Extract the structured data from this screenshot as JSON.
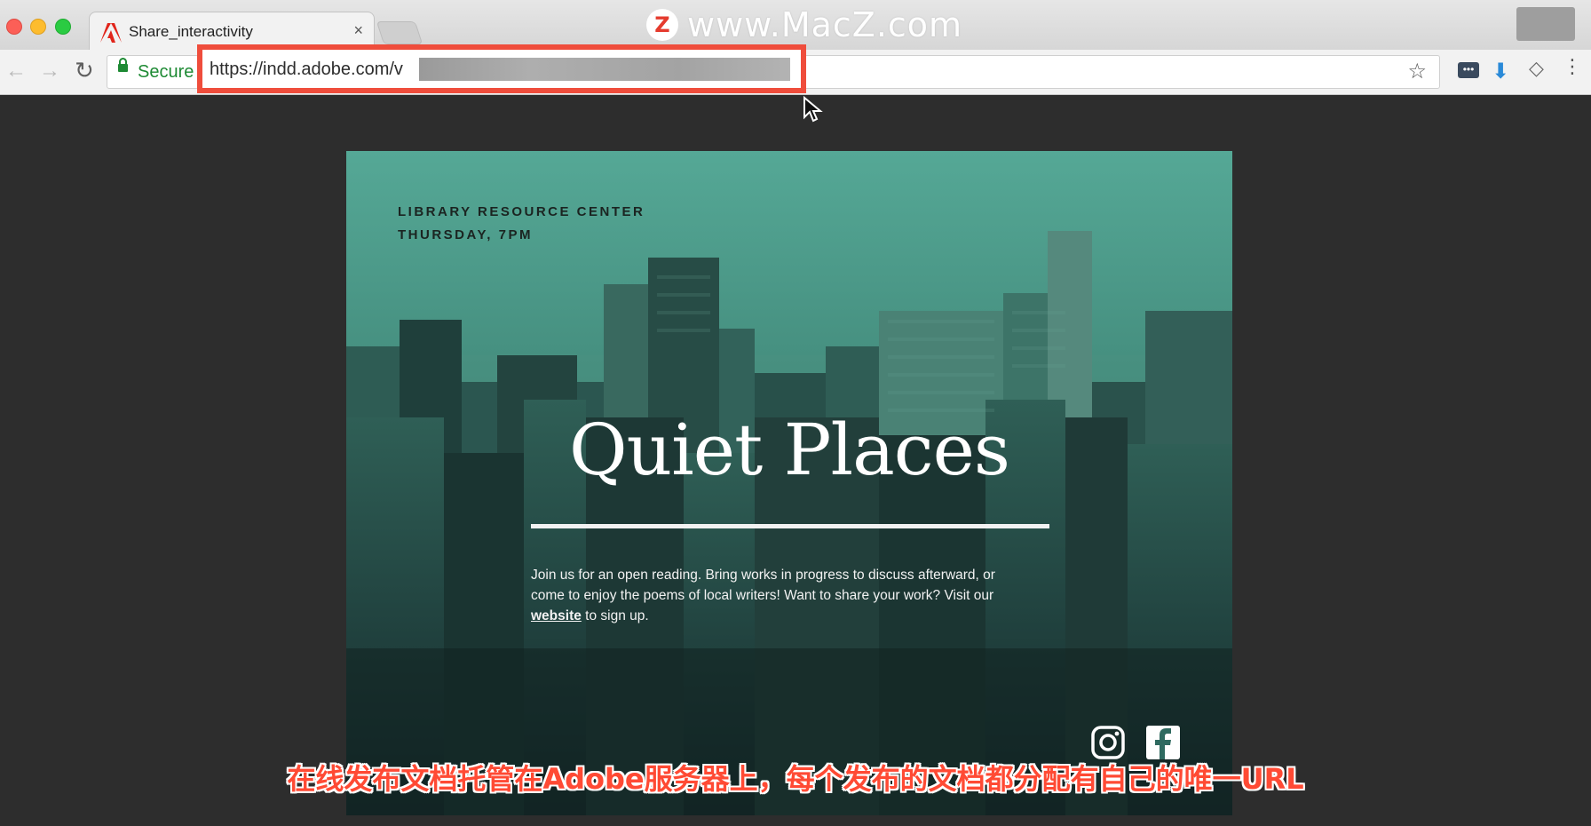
{
  "browser": {
    "tab_title": "Share_interactivity",
    "tab_close_glyph": "×",
    "watermark_text": "www.MacZ.com",
    "watermark_logo_letter": "Z",
    "secure_label": "Secure",
    "url_visible_prefix": "https://indd.adobe.com/v",
    "icons": [
      "back-arrow-icon",
      "forward-arrow-icon",
      "reload-icon",
      "lock-icon",
      "star-icon",
      "extension-icon",
      "download-icon",
      "diamond-icon",
      "menu-dots-icon"
    ],
    "colors": {
      "secure_green": "#1e8a34",
      "highlight_red": "#ef4d3c"
    }
  },
  "poster": {
    "header_line1": "LIBRARY RESOURCE CENTER",
    "header_line2": "THURSDAY, 7PM",
    "headline": "Quiet Places",
    "body_part1": "Join us for an open reading. Bring works in progress to discuss afterward, or come to enjoy the poems of local writers! Want to share your work? Visit our ",
    "body_link": "website",
    "body_part2": " to sign up.",
    "social_icons": [
      "instagram-icon",
      "facebook-icon"
    ],
    "tint_color": "#2f6a60"
  },
  "caption": {
    "text": "在线发布文档托管在Adobe服务器上，每个发布的文档都分配有自己的唯一URL",
    "color": "#ff4a34"
  }
}
